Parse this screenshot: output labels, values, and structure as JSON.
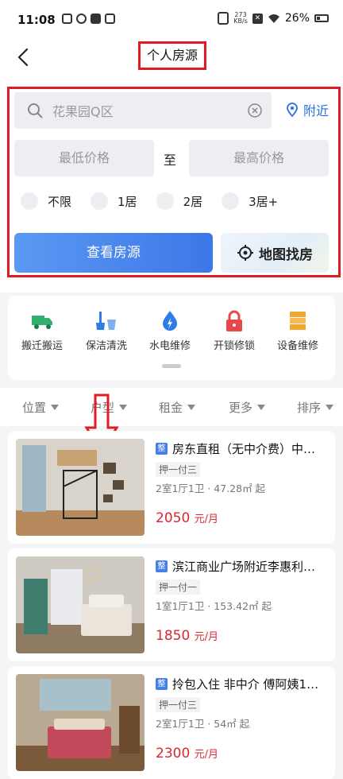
{
  "status_bar": {
    "time": "11:08",
    "net_speed_top": "273",
    "net_speed_bottom": "KB/s",
    "battery": "26%"
  },
  "header": {
    "title": "个人房源"
  },
  "search": {
    "placeholder": "花果园Q区",
    "nearby_label": "附近",
    "price_min_placeholder": "最低价格",
    "price_separator": "至",
    "price_max_placeholder": "最高价格",
    "room_options": [
      "不限",
      "1居",
      "2居",
      "3居+"
    ],
    "search_button": "查看房源",
    "map_button": "地图找房"
  },
  "services": [
    {
      "label": "搬迁搬运",
      "icon": "truck-icon"
    },
    {
      "label": "保洁清洗",
      "icon": "broom-icon"
    },
    {
      "label": "水电维修",
      "icon": "water-drop-icon"
    },
    {
      "label": "开锁修锁",
      "icon": "lock-icon"
    },
    {
      "label": "设备维修",
      "icon": "device-icon"
    }
  ],
  "filters": [
    "位置",
    "户型",
    "租金",
    "更多",
    "排序"
  ],
  "listings": [
    {
      "badge": "整",
      "title": "房东直租（无中介费）中…",
      "payment": "押一付三",
      "spec": "2室1厅1卫 · 47.28㎡ 起",
      "price": "2050",
      "unit": "元/月"
    },
    {
      "badge": "整",
      "title": "滨江商业广场附近李惠利…",
      "payment": "押一付一",
      "spec": "1室1厅1卫 · 153.42㎡ 起",
      "price": "1850",
      "unit": "元/月"
    },
    {
      "badge": "整",
      "title": "拎包入住 非中介 傅阿姨1…",
      "payment": "押一付三",
      "spec": "2室1厅1卫 · 54㎡ 起",
      "price": "2300",
      "unit": "元/月"
    }
  ],
  "colors": {
    "accent": "#3d77e8",
    "price": "#d9282f",
    "annotation": "#e01b23"
  }
}
